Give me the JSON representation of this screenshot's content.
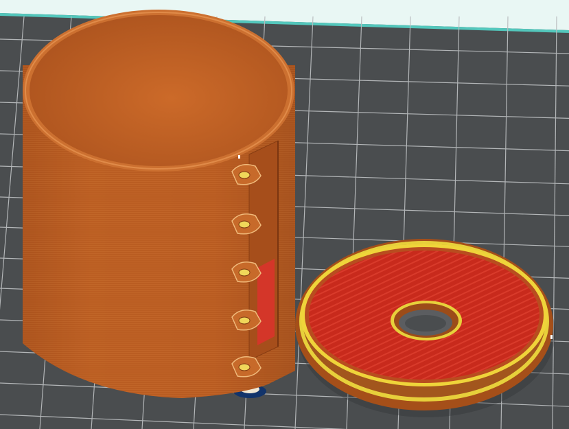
{
  "viewport": {
    "label": "",
    "colors": {
      "plate": "#4a4d4f",
      "grid": "#b9bcbe",
      "backdrop": "#dff3ef",
      "accentStrip": "#53c7bc",
      "cupBody": "#b95d22",
      "cupEdge": "#d47a36",
      "cupDark": "#8f4417",
      "infill": "#c82a1c",
      "perimeter": "#f2d33a",
      "support": "#1d3f7a"
    },
    "objects": [
      {
        "name": "cylinder-cup",
        "type": "sliced-part"
      },
      {
        "name": "lid-disc",
        "type": "sliced-part"
      }
    ]
  }
}
